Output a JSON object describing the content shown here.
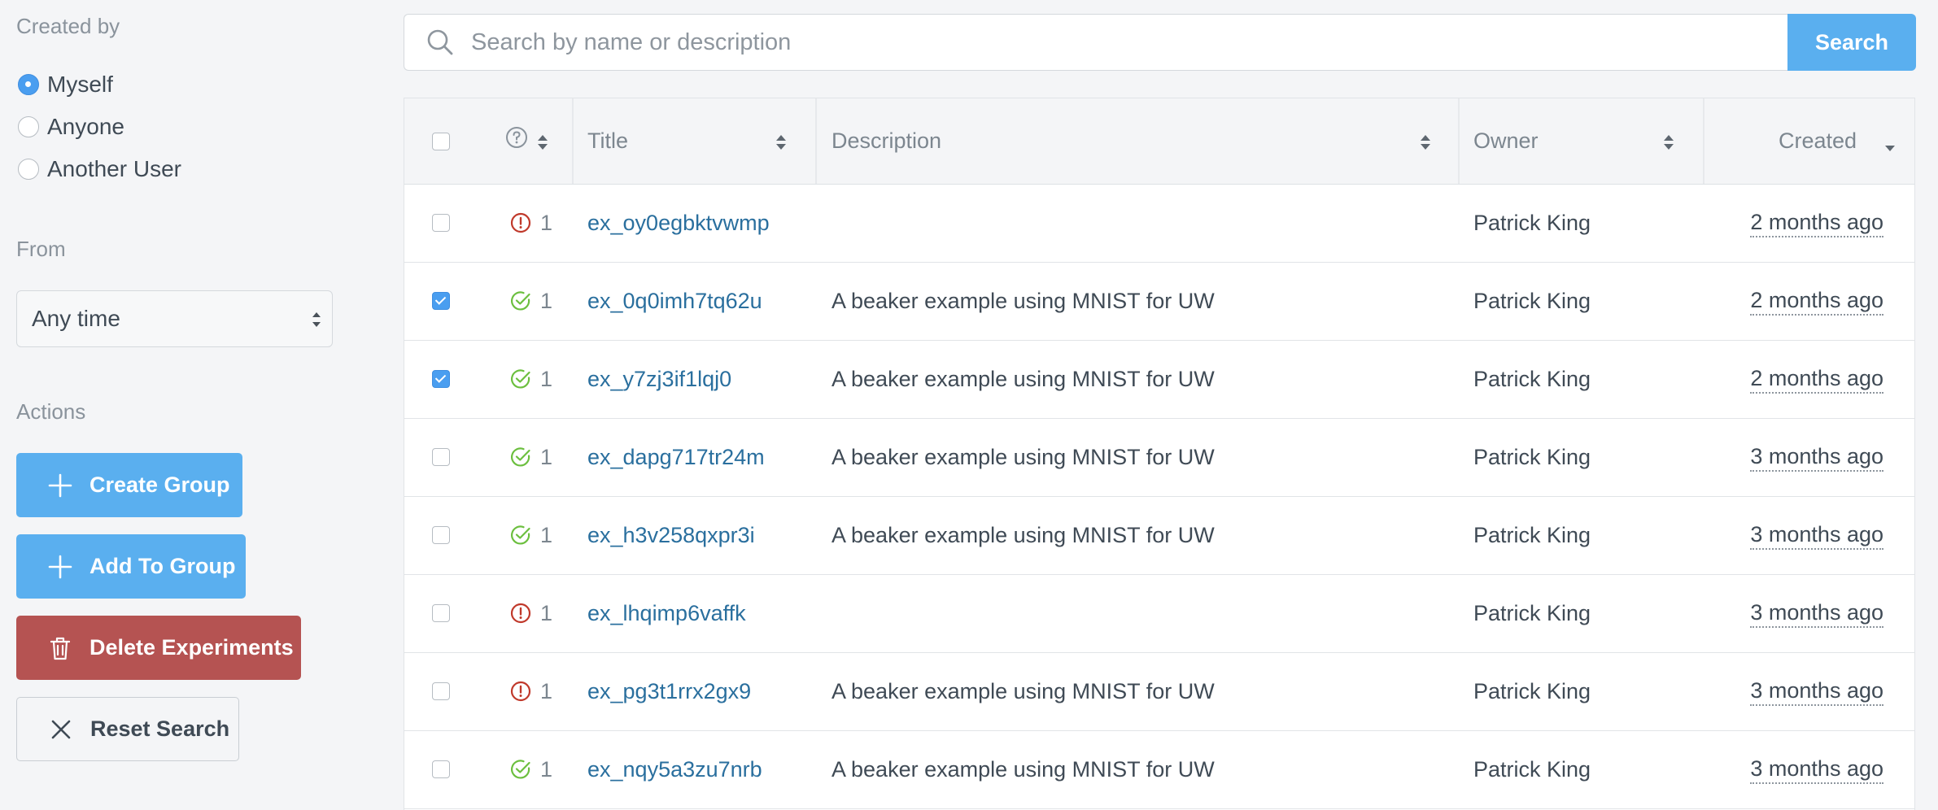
{
  "sidebar": {
    "created_by_label": "Created by",
    "created_by_options": [
      {
        "label": "Myself",
        "checked": true
      },
      {
        "label": "Anyone",
        "checked": false
      },
      {
        "label": "Another User",
        "checked": false
      }
    ],
    "from_label": "From",
    "from_value": "Any time",
    "actions_label": "Actions",
    "buttons": {
      "create_group": "Create Group",
      "add_to_group": "Add To Group",
      "delete_experiments": "Delete Experiments",
      "reset_search": "Reset Search"
    }
  },
  "search": {
    "placeholder": "Search by name or description",
    "value": "",
    "button_label": "Search"
  },
  "table": {
    "columns": {
      "title": "Title",
      "description": "Description",
      "owner": "Owner",
      "created": "Created"
    },
    "rows": [
      {
        "checked": false,
        "status": "error",
        "count": "1",
        "title": "ex_oy0egbktvwmp",
        "description": "",
        "owner": "Patrick King",
        "created": "2 months ago"
      },
      {
        "checked": true,
        "status": "success",
        "count": "1",
        "title": "ex_0q0imh7tq62u",
        "description": "A beaker example using MNIST for UW",
        "owner": "Patrick King",
        "created": "2 months ago"
      },
      {
        "checked": true,
        "status": "success",
        "count": "1",
        "title": "ex_y7zj3if1lqj0",
        "description": "A beaker example using MNIST for UW",
        "owner": "Patrick King",
        "created": "2 months ago"
      },
      {
        "checked": false,
        "status": "success",
        "count": "1",
        "title": "ex_dapg717tr24m",
        "description": "A beaker example using MNIST for UW",
        "owner": "Patrick King",
        "created": "3 months ago"
      },
      {
        "checked": false,
        "status": "success",
        "count": "1",
        "title": "ex_h3v258qxpr3i",
        "description": "A beaker example using MNIST for UW",
        "owner": "Patrick King",
        "created": "3 months ago"
      },
      {
        "checked": false,
        "status": "error",
        "count": "1",
        "title": "ex_lhqimp6vaffk",
        "description": "",
        "owner": "Patrick King",
        "created": "3 months ago"
      },
      {
        "checked": false,
        "status": "error",
        "count": "1",
        "title": "ex_pg3t1rrx2gx9",
        "description": "A beaker example using MNIST for UW",
        "owner": "Patrick King",
        "created": "3 months ago"
      },
      {
        "checked": false,
        "status": "success",
        "count": "1",
        "title": "ex_nqy5a3zu7nrb",
        "description": "A beaker example using MNIST for UW",
        "owner": "Patrick King",
        "created": "3 months ago"
      }
    ]
  },
  "colors": {
    "accent": "#5aafef",
    "danger": "#b55352",
    "link": "#2a6f9e",
    "status_success": "#6cbf3f",
    "status_error": "#c0392b"
  },
  "icons": {
    "search": "search-icon",
    "plus": "plus-icon",
    "trash": "trash-icon",
    "close": "close-icon",
    "help": "help-circle-icon",
    "success": "check-circle-icon",
    "error": "alert-circle-icon"
  }
}
